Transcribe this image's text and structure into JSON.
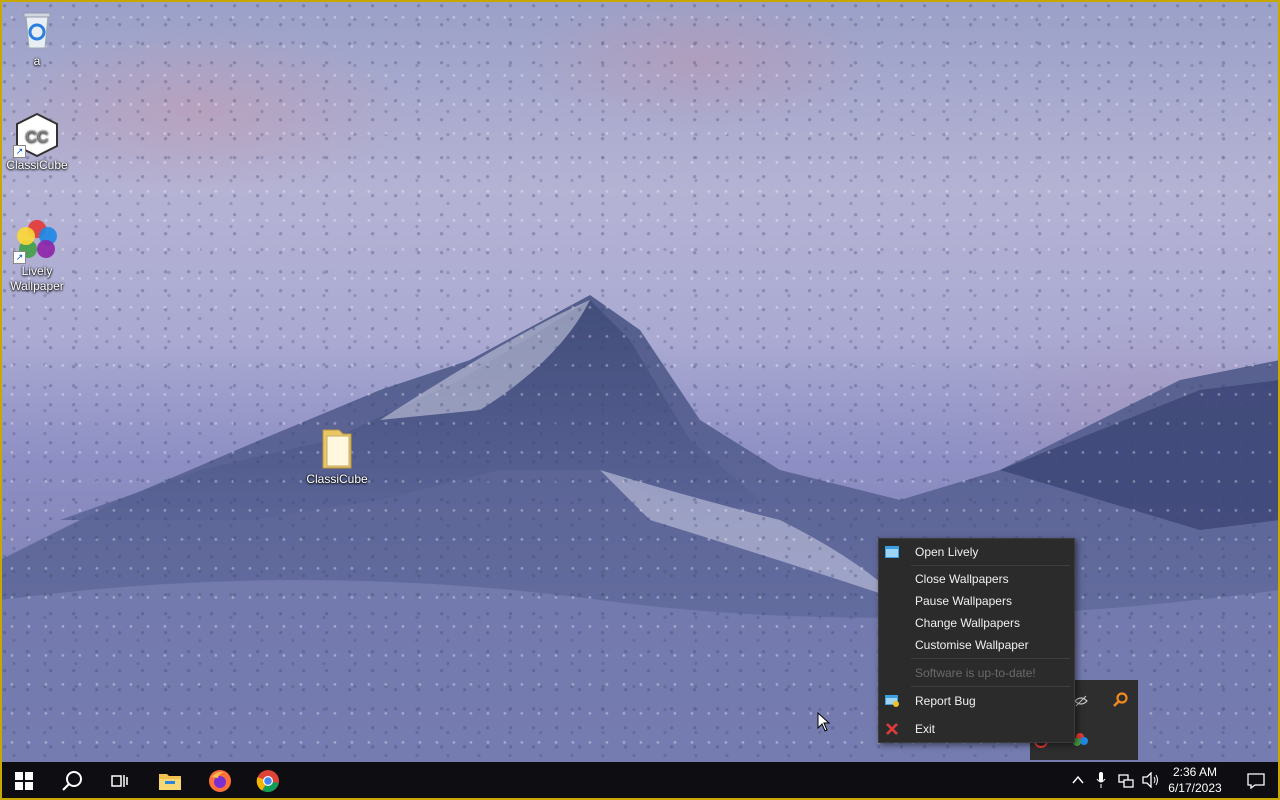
{
  "desktop": {
    "icons": [
      {
        "label": "a",
        "icon": "recycle-bin-icon"
      },
      {
        "label": "ClassiCube",
        "icon": "classicube-icon"
      },
      {
        "label": "Lively Wallpaper",
        "icon": "lively-wallpaper-icon"
      },
      {
        "label": "ClassiCube",
        "icon": "folder-icon"
      }
    ]
  },
  "context_menu": {
    "items": [
      {
        "label": "Open Lively",
        "icon": "lively-window-icon",
        "enabled": true
      },
      {
        "label": "Close Wallpapers",
        "enabled": true
      },
      {
        "label": "Pause Wallpapers",
        "enabled": true
      },
      {
        "label": "Change Wallpapers",
        "enabled": true
      },
      {
        "label": "Customise Wallpaper",
        "enabled": true
      },
      {
        "label": "Software is up-to-date!",
        "enabled": false
      },
      {
        "label": "Report Bug",
        "icon": "report-bug-icon",
        "enabled": true
      },
      {
        "label": "Exit",
        "icon": "exit-x-icon",
        "enabled": true
      }
    ]
  },
  "taskbar": {
    "pinned": [
      "start-windows-icon",
      "search-icon",
      "task-view-icon",
      "file-explorer-icon",
      "firefox-icon",
      "chrome-icon"
    ],
    "tray": [
      "chevron-up-icon",
      "microphone-icon",
      "network-icon",
      "volume-icon"
    ],
    "clock": {
      "time": "2:36 AM",
      "date": "6/17/2023"
    }
  },
  "colors": {
    "menu_bg": "#2b2b2b",
    "taskbar_bg": "#0d0d12",
    "exit_red": "#e03a3a"
  }
}
